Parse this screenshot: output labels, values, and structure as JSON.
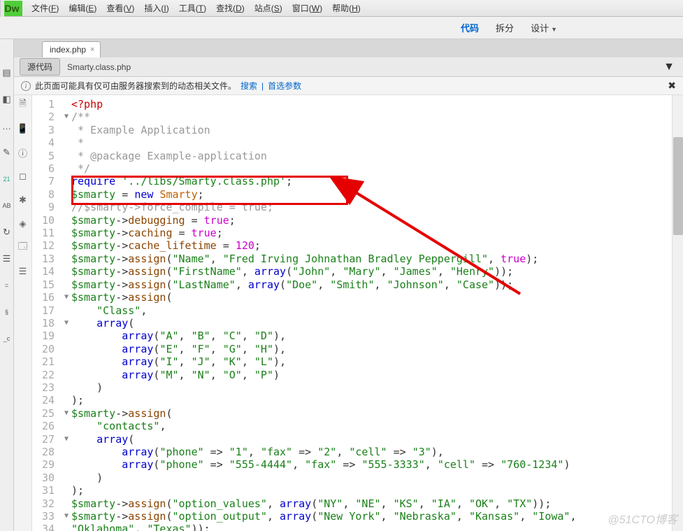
{
  "logo": "Dw",
  "menubar": [
    {
      "label": "文件",
      "accel": "F"
    },
    {
      "label": "编辑",
      "accel": "E"
    },
    {
      "label": "查看",
      "accel": "V"
    },
    {
      "label": "插入",
      "accel": "I"
    },
    {
      "label": "工具",
      "accel": "T"
    },
    {
      "label": "查找",
      "accel": "D"
    },
    {
      "label": "站点",
      "accel": "S"
    },
    {
      "label": "窗口",
      "accel": "W"
    },
    {
      "label": "帮助",
      "accel": "H"
    }
  ],
  "viewmodes": {
    "code": "代码",
    "split": "拆分",
    "design": "设计"
  },
  "tab": {
    "name": "index.php"
  },
  "srcrow": {
    "source_btn": "源代码",
    "file": "Smarty.class.php"
  },
  "infobar": {
    "text": "此页面可能具有仅可由服务器搜索到的动态相关文件。",
    "link1": "搜索",
    "link2": "首选参数"
  },
  "code_lines": [
    {
      "n": 1,
      "fold": "",
      "html": "<span class='tagopen'>&lt;?php</span>"
    },
    {
      "n": 2,
      "fold": "▼",
      "html": "<span class='com'>/**</span>"
    },
    {
      "n": 3,
      "fold": "",
      "html": "<span class='com'> * Example Application</span>"
    },
    {
      "n": 4,
      "fold": "",
      "html": "<span class='com'> *</span>"
    },
    {
      "n": 5,
      "fold": "",
      "html": "<span class='com'> * @package Example-application</span>"
    },
    {
      "n": 6,
      "fold": "",
      "html": "<span class='com'> */</span>"
    },
    {
      "n": 7,
      "fold": "",
      "html": "<span class='kw'>require</span> <span class='str'>'../libs/Smarty.class.php'</span>;"
    },
    {
      "n": 8,
      "fold": "",
      "html": "<span class='var'>$smarty</span> = <span class='kw'>new</span> <span class='cls'>Smarty</span>;"
    },
    {
      "n": 9,
      "fold": "",
      "html": "<span class='com'>//$smarty-&gt;force_compile = true;</span>"
    },
    {
      "n": 10,
      "fold": "",
      "html": "<span class='var'>$smarty</span>-&gt;<span class='fn'>debugging</span> = <span class='num'>true</span>;"
    },
    {
      "n": 11,
      "fold": "",
      "html": "<span class='var'>$smarty</span>-&gt;<span class='fn'>caching</span> = <span class='num'>true</span>;"
    },
    {
      "n": 12,
      "fold": "",
      "html": "<span class='var'>$smarty</span>-&gt;<span class='fn'>cache_lifetime</span> = <span class='num'>120</span>;"
    },
    {
      "n": 13,
      "fold": "",
      "html": "<span class='var'>$smarty</span>-&gt;<span class='fn'>assign</span>(<span class='str'>\"Name\"</span>, <span class='str'>\"Fred Irving Johnathan Bradley Peppergill\"</span>, <span class='num'>true</span>);"
    },
    {
      "n": 14,
      "fold": "",
      "html": "<span class='var'>$smarty</span>-&gt;<span class='fn'>assign</span>(<span class='str'>\"FirstName\"</span>, <span class='kw'>array</span>(<span class='str'>\"John\"</span>, <span class='str'>\"Mary\"</span>, <span class='str'>\"James\"</span>, <span class='str'>\"Henry\"</span>));"
    },
    {
      "n": 15,
      "fold": "",
      "html": "<span class='var'>$smarty</span>-&gt;<span class='fn'>assign</span>(<span class='str'>\"LastName\"</span>, <span class='kw'>array</span>(<span class='str'>\"Doe\"</span>, <span class='str'>\"Smith\"</span>, <span class='str'>\"Johnson\"</span>, <span class='str'>\"Case\"</span>));"
    },
    {
      "n": 16,
      "fold": "▼",
      "html": "<span class='var'>$smarty</span>-&gt;<span class='fn'>assign</span>("
    },
    {
      "n": 17,
      "fold": "",
      "html": "    <span class='str'>\"Class\"</span>,"
    },
    {
      "n": 18,
      "fold": "▼",
      "html": "    <span class='kw'>array</span>("
    },
    {
      "n": 19,
      "fold": "",
      "html": "        <span class='kw'>array</span>(<span class='str'>\"A\"</span>, <span class='str'>\"B\"</span>, <span class='str'>\"C\"</span>, <span class='str'>\"D\"</span>),"
    },
    {
      "n": 20,
      "fold": "",
      "html": "        <span class='kw'>array</span>(<span class='str'>\"E\"</span>, <span class='str'>\"F\"</span>, <span class='str'>\"G\"</span>, <span class='str'>\"H\"</span>),"
    },
    {
      "n": 21,
      "fold": "",
      "html": "        <span class='kw'>array</span>(<span class='str'>\"I\"</span>, <span class='str'>\"J\"</span>, <span class='str'>\"K\"</span>, <span class='str'>\"L\"</span>),"
    },
    {
      "n": 22,
      "fold": "",
      "html": "        <span class='kw'>array</span>(<span class='str'>\"M\"</span>, <span class='str'>\"N\"</span>, <span class='str'>\"O\"</span>, <span class='str'>\"P\"</span>)"
    },
    {
      "n": 23,
      "fold": "",
      "html": "    )"
    },
    {
      "n": 24,
      "fold": "",
      "html": ");"
    },
    {
      "n": 25,
      "fold": "▼",
      "html": "<span class='var'>$smarty</span>-&gt;<span class='fn'>assign</span>("
    },
    {
      "n": 26,
      "fold": "",
      "html": "    <span class='str'>\"contacts\"</span>,"
    },
    {
      "n": 27,
      "fold": "▼",
      "html": "    <span class='kw'>array</span>("
    },
    {
      "n": 28,
      "fold": "",
      "html": "        <span class='kw'>array</span>(<span class='str'>\"phone\"</span> =&gt; <span class='str'>\"1\"</span>, <span class='str'>\"fax\"</span> =&gt; <span class='str'>\"2\"</span>, <span class='str'>\"cell\"</span> =&gt; <span class='str'>\"3\"</span>),"
    },
    {
      "n": 29,
      "fold": "",
      "html": "        <span class='kw'>array</span>(<span class='str'>\"phone\"</span> =&gt; <span class='str'>\"555-4444\"</span>, <span class='str'>\"fax\"</span> =&gt; <span class='str'>\"555-3333\"</span>, <span class='str'>\"cell\"</span> =&gt; <span class='str'>\"760-1234\"</span>)"
    },
    {
      "n": 30,
      "fold": "",
      "html": "    )"
    },
    {
      "n": 31,
      "fold": "",
      "html": ");"
    },
    {
      "n": 32,
      "fold": "",
      "html": "<span class='var'>$smarty</span>-&gt;<span class='fn'>assign</span>(<span class='str'>\"option_values\"</span>, <span class='kw'>array</span>(<span class='str'>\"NY\"</span>, <span class='str'>\"NE\"</span>, <span class='str'>\"KS\"</span>, <span class='str'>\"IA\"</span>, <span class='str'>\"OK\"</span>, <span class='str'>\"TX\"</span>));"
    },
    {
      "n": 33,
      "fold": "▼",
      "html": "<span class='var'>$smarty</span>-&gt;<span class='fn'>assign</span>(<span class='str'>\"option_output\"</span>, <span class='kw'>array</span>(<span class='str'>\"New York\"</span>, <span class='str'>\"Nebraska\"</span>, <span class='str'>\"Kansas\"</span>, <span class='str'>\"Iowa\"</span>,"
    },
    {
      "n": 34,
      "fold": "",
      "html": "<span class='str'>\"Oklahoma\"</span>, <span class='str'>\"Texas\"</span>));"
    }
  ],
  "gutter_icons": [
    "list",
    "split",
    "finder",
    "comment",
    "date21",
    "spell",
    "sync",
    "page",
    "_c"
  ],
  "code_gutter_icons": [
    "file",
    "phone",
    "lock",
    "square",
    "strike",
    "play",
    "text",
    "list"
  ],
  "watermark": "@51CTO博客"
}
